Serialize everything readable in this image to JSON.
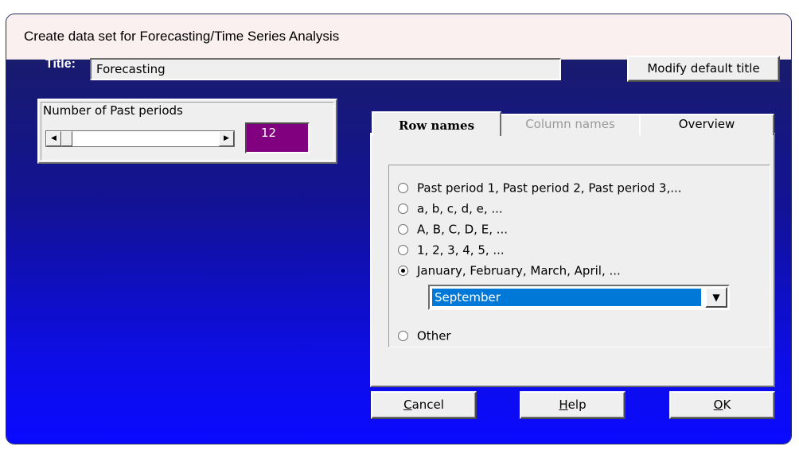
{
  "window": {
    "title": "Create data set for Forecasting/Time Series Analysis"
  },
  "title_row": {
    "label": "Title:",
    "value": "Forecasting",
    "modify_button": "Modify default title"
  },
  "past_periods": {
    "label": "Number of Past periods",
    "value": "12",
    "scroll_left_icon": "arrow-left-icon",
    "scroll_right_icon": "arrow-right-icon"
  },
  "tabs": [
    {
      "label": "Row names",
      "active": true
    },
    {
      "label": "Column names",
      "active": false
    },
    {
      "label": "Overview",
      "active": false
    }
  ],
  "row_name_options": [
    {
      "label": "Past period 1, Past period 2, Past period 3,...",
      "selected": false
    },
    {
      "label": "a, b, c, d, e, ...",
      "selected": false
    },
    {
      "label": "A, B, C, D, E, ...",
      "selected": false
    },
    {
      "label": "1, 2, 3, 4, 5, ...",
      "selected": false
    },
    {
      "label": "January, February, March, April, ...",
      "selected": true
    },
    {
      "label": "Other",
      "selected": false
    }
  ],
  "month_select": {
    "value": "September",
    "icon": "chevron-down-icon"
  },
  "buttons": {
    "cancel": {
      "label": "Cancel",
      "accel_first": "C",
      "accel_rest": "ancel"
    },
    "help": {
      "label": "Help",
      "accel_first": "H",
      "accel_rest": "elp"
    },
    "ok": {
      "label": "OK",
      "accel_first": "O",
      "accel_rest": "K"
    }
  },
  "colors": {
    "period_value_bg": "#800080",
    "selection_bg": "#0078d7",
    "window_gradient_top": "#1b1e60",
    "window_gradient_bottom": "#0a0aff"
  }
}
